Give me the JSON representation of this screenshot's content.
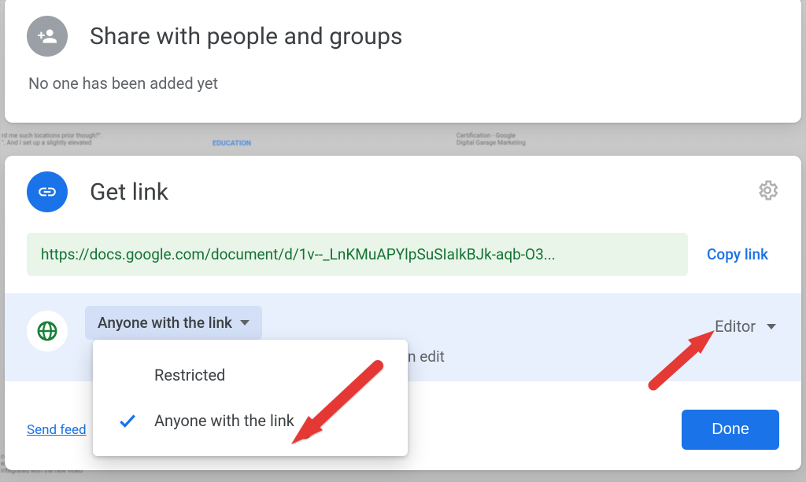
{
  "share_panel": {
    "title": "Share with people and groups",
    "subtitle": "No one has been added yet"
  },
  "link_panel": {
    "title": "Get link",
    "url": "https://docs.google.com/document/d/1v--_LnKMuAPYlpSuSIaIkBJk-aqb-O3...",
    "copy_label": "Copy link",
    "scope_label": "Anyone with the link",
    "scope_desc_fragment": "n edit",
    "role_label": "Editor",
    "feedback_label": "Send feed",
    "done_label": "Done"
  },
  "scope_options": {
    "restricted": "Restricted",
    "anyone": "Anyone with the link"
  }
}
